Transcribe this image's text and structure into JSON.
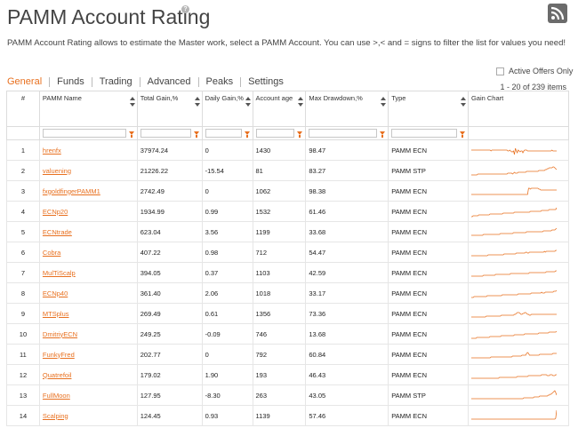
{
  "header": {
    "title": "PAMM Account Rating",
    "help_symbol": "?",
    "description": "PAMM Account Rating allows to estimate the Master work, select a PAMM Account. You can use >,< and = signs to filter the list for values you need!"
  },
  "tabs": [
    {
      "label": "General",
      "active": true
    },
    {
      "label": "Funds",
      "active": false
    },
    {
      "label": "Trading",
      "active": false
    },
    {
      "label": "Advanced",
      "active": false
    },
    {
      "label": "Peaks",
      "active": false
    },
    {
      "label": "Settings",
      "active": false
    }
  ],
  "filter_toggle": {
    "label": "Active Offers Only",
    "checked": false
  },
  "pagination": {
    "text": "1 - 20 of 239 items"
  },
  "columns": [
    {
      "label": "#"
    },
    {
      "label": "PAMM Name"
    },
    {
      "label": "Total Gain,%"
    },
    {
      "label": "Daily Gain,%"
    },
    {
      "label": "Account age"
    },
    {
      "label": "Max Drawdown,%"
    },
    {
      "label": "Type"
    },
    {
      "label": "Gain Chart"
    }
  ],
  "rows": [
    {
      "n": "1",
      "name": "hrenfx",
      "total": "37974.24",
      "daily": "0",
      "age": "1430",
      "dd": "98.47",
      "type": "PAMM ECN",
      "spark": [
        8,
        8,
        8,
        8,
        8,
        8,
        8,
        8,
        8,
        8,
        8,
        8,
        8,
        8,
        8,
        8,
        8,
        8,
        8,
        8,
        8,
        9,
        8,
        8,
        8,
        8,
        8,
        8,
        8,
        8,
        8,
        8,
        8,
        8,
        8,
        8,
        8,
        8,
        8,
        9,
        9,
        8,
        9,
        10,
        10,
        9,
        13,
        6,
        9,
        11,
        8,
        9,
        10,
        9,
        9,
        11,
        9,
        8,
        8,
        8,
        9,
        9,
        9,
        9,
        9,
        9,
        9,
        9,
        9,
        9,
        9,
        9,
        9,
        9,
        9,
        9,
        9,
        9,
        9,
        9,
        9,
        9,
        9,
        9,
        9,
        9,
        8,
        9,
        9,
        9,
        9,
        9
      ]
    },
    {
      "n": "2",
      "name": "valuening",
      "total": "21226.22",
      "daily": "-15.54",
      "age": "81",
      "dd": "83.27",
      "type": "PAMM STP",
      "spark": [
        13,
        13,
        13,
        13,
        13,
        13,
        13,
        12,
        12,
        12,
        12,
        12,
        12,
        12,
        12,
        12,
        12,
        12,
        12,
        12,
        12,
        12,
        12,
        12,
        12,
        12,
        12,
        12,
        12,
        12,
        12,
        12,
        12,
        12,
        12,
        12,
        12,
        12,
        12,
        11,
        11,
        11,
        11,
        11,
        12,
        11,
        10,
        11,
        11,
        11,
        10,
        10,
        10,
        10,
        10,
        10,
        10,
        10,
        10,
        9,
        9,
        9,
        9,
        9,
        9,
        9,
        9,
        9,
        9,
        9,
        9,
        9,
        8,
        8,
        8,
        8,
        8,
        8,
        8,
        7,
        7,
        6,
        6,
        5,
        5,
        5,
        5,
        4,
        4,
        5,
        6,
        7
      ]
    },
    {
      "n": "3",
      "name": "fxgoldfingerPAMM1",
      "total": "2742.49",
      "daily": "0",
      "age": "1062",
      "dd": "98.38",
      "type": "PAMM ECN",
      "spark": [
        12,
        12,
        12,
        12,
        12,
        12,
        12,
        12,
        12,
        12,
        12,
        12,
        12,
        12,
        12,
        12,
        12,
        12,
        12,
        12,
        12,
        12,
        12,
        12,
        12,
        12,
        12,
        12,
        12,
        12,
        12,
        12,
        12,
        12,
        12,
        12,
        12,
        12,
        12,
        12,
        12,
        12,
        12,
        12,
        12,
        12,
        12,
        12,
        12,
        12,
        12,
        12,
        12,
        12,
        12,
        12,
        12,
        12,
        12,
        12,
        12,
        5,
        5,
        6,
        5,
        5,
        5,
        5,
        5,
        5,
        5,
        5,
        6,
        6,
        7,
        7,
        7,
        7,
        7,
        7,
        7,
        7,
        7,
        7,
        7,
        7,
        7,
        7,
        7,
        7,
        7,
        7
      ]
    },
    {
      "n": "4",
      "name": "ECNp20",
      "total": "1934.99",
      "daily": "0.99",
      "age": "1532",
      "dd": "61.46",
      "type": "PAMM ECN",
      "spark": [
        14,
        14,
        13,
        13,
        13,
        13,
        13,
        13,
        12,
        12,
        12,
        12,
        12,
        12,
        12,
        12,
        12,
        12,
        12,
        12,
        11,
        11,
        11,
        11,
        11,
        11,
        11,
        11,
        11,
        11,
        11,
        11,
        11,
        11,
        10,
        10,
        10,
        10,
        10,
        10,
        10,
        10,
        10,
        10,
        10,
        10,
        9,
        9,
        9,
        9,
        9,
        9,
        9,
        9,
        9,
        9,
        9,
        9,
        9,
        9,
        9,
        9,
        9,
        8,
        8,
        8,
        8,
        8,
        8,
        8,
        8,
        8,
        8,
        8,
        8,
        7,
        7,
        7,
        7,
        7,
        7,
        7,
        7,
        6,
        6,
        6,
        6,
        6,
        6,
        6,
        6,
        4
      ]
    },
    {
      "n": "5",
      "name": "ECNtrade",
      "total": "623.04",
      "daily": "3.56",
      "age": "1199",
      "dd": "33.68",
      "type": "PAMM ECN",
      "spark": [
        12,
        12,
        12,
        12,
        12,
        12,
        12,
        12,
        12,
        12,
        12,
        12,
        12,
        11,
        11,
        11,
        11,
        11,
        11,
        11,
        11,
        11,
        11,
        11,
        11,
        11,
        11,
        11,
        11,
        11,
        11,
        10,
        10,
        10,
        10,
        10,
        10,
        10,
        10,
        10,
        10,
        10,
        10,
        10,
        10,
        9,
        9,
        9,
        9,
        9,
        9,
        9,
        9,
        9,
        9,
        9,
        9,
        9,
        9,
        8,
        8,
        8,
        8,
        8,
        8,
        8,
        8,
        8,
        8,
        8,
        8,
        8,
        8,
        8,
        8,
        8,
        8,
        7,
        7,
        7,
        7,
        7,
        7,
        7,
        7,
        7,
        6,
        6,
        6,
        6,
        5,
        4
      ]
    },
    {
      "n": "6",
      "name": "Cobra",
      "total": "407.22",
      "daily": "0.98",
      "age": "712",
      "dd": "54.47",
      "type": "PAMM ECN",
      "spark": [
        12,
        12,
        12,
        12,
        12,
        12,
        12,
        12,
        12,
        12,
        12,
        12,
        12,
        12,
        12,
        12,
        12,
        12,
        11,
        11,
        11,
        11,
        11,
        11,
        11,
        11,
        11,
        11,
        11,
        11,
        11,
        11,
        11,
        11,
        11,
        10,
        10,
        10,
        10,
        10,
        10,
        10,
        10,
        10,
        10,
        10,
        10,
        10,
        9,
        9,
        9,
        9,
        9,
        9,
        9,
        9,
        9,
        9,
        8,
        8,
        9,
        9,
        8,
        8,
        8,
        8,
        8,
        8,
        8,
        8,
        8,
        8,
        8,
        8,
        8,
        8,
        8,
        8,
        7,
        8,
        7,
        7,
        7,
        7,
        7,
        7,
        7,
        7,
        7,
        7,
        6,
        6
      ]
    },
    {
      "n": "7",
      "name": "MulTiScalp",
      "total": "394.05",
      "daily": "0.37",
      "age": "1103",
      "dd": "42.59",
      "type": "PAMM ECN",
      "spark": [
        12,
        12,
        12,
        12,
        12,
        12,
        12,
        12,
        12,
        12,
        12,
        12,
        12,
        11,
        11,
        11,
        11,
        11,
        11,
        11,
        11,
        11,
        11,
        11,
        11,
        11,
        10,
        10,
        10,
        10,
        10,
        10,
        10,
        10,
        10,
        10,
        10,
        10,
        10,
        10,
        10,
        10,
        9,
        9,
        9,
        9,
        9,
        9,
        9,
        9,
        9,
        9,
        9,
        9,
        9,
        9,
        9,
        9,
        9,
        9,
        9,
        9,
        8,
        8,
        8,
        8,
        8,
        8,
        8,
        8,
        8,
        8,
        8,
        8,
        8,
        8,
        8,
        8,
        8,
        8,
        7,
        7,
        7,
        7,
        7,
        7,
        7,
        7,
        7,
        7,
        6,
        6
      ]
    },
    {
      "n": "8",
      "name": "ECNp40",
      "total": "361.40",
      "daily": "2.06",
      "age": "1018",
      "dd": "33.17",
      "type": "PAMM ECN",
      "spark": [
        13,
        13,
        13,
        12,
        12,
        12,
        12,
        12,
        12,
        12,
        12,
        12,
        12,
        12,
        12,
        12,
        12,
        11,
        11,
        11,
        11,
        11,
        11,
        11,
        11,
        11,
        11,
        11,
        11,
        11,
        11,
        11,
        11,
        10,
        10,
        10,
        10,
        10,
        10,
        10,
        10,
        10,
        10,
        10,
        10,
        10,
        10,
        10,
        10,
        10,
        9,
        9,
        9,
        9,
        9,
        9,
        9,
        9,
        9,
        9,
        9,
        9,
        9,
        9,
        8,
        8,
        8,
        8,
        8,
        8,
        8,
        8,
        8,
        8,
        8,
        7,
        8,
        8,
        8,
        7,
        7,
        7,
        7,
        7,
        7,
        7,
        7,
        7,
        6,
        6,
        6,
        5
      ]
    },
    {
      "n": "9",
      "name": "MTSplus",
      "total": "269.49",
      "daily": "0.61",
      "age": "1356",
      "dd": "73.36",
      "type": "PAMM ECN",
      "spark": [
        12,
        12,
        12,
        12,
        12,
        12,
        12,
        12,
        12,
        12,
        12,
        12,
        12,
        12,
        12,
        12,
        11,
        11,
        11,
        11,
        11,
        11,
        11,
        11,
        11,
        11,
        11,
        11,
        11,
        11,
        11,
        11,
        10,
        10,
        10,
        10,
        10,
        10,
        10,
        10,
        10,
        10,
        10,
        10,
        10,
        10,
        9,
        9,
        8,
        7,
        7,
        7,
        8,
        9,
        9,
        8,
        8,
        7,
        7,
        8,
        9,
        9,
        10,
        10,
        9,
        9,
        9,
        9,
        9,
        9,
        9,
        9,
        9,
        9,
        9,
        9,
        9,
        9,
        9,
        9,
        9,
        9,
        9,
        9,
        9,
        9,
        9,
        9,
        9,
        9,
        9,
        9
      ]
    },
    {
      "n": "10",
      "name": "DmitriyECN",
      "total": "249.25",
      "daily": "-0.09",
      "age": "746",
      "dd": "13.68",
      "type": "PAMM ECN",
      "spark": [
        13,
        13,
        13,
        13,
        13,
        13,
        12,
        12,
        12,
        12,
        12,
        12,
        12,
        12,
        12,
        12,
        12,
        12,
        12,
        12,
        11,
        11,
        11,
        11,
        11,
        11,
        11,
        11,
        11,
        11,
        11,
        11,
        10,
        10,
        10,
        10,
        10,
        10,
        10,
        10,
        10,
        10,
        10,
        10,
        10,
        10,
        9,
        9,
        9,
        9,
        9,
        9,
        9,
        9,
        9,
        9,
        9,
        8,
        8,
        8,
        8,
        8,
        8,
        8,
        8,
        8,
        8,
        8,
        8,
        8,
        8,
        8,
        7,
        7,
        7,
        7,
        7,
        7,
        7,
        7,
        7,
        7,
        7,
        6,
        6,
        6,
        6,
        6,
        6,
        6,
        6,
        5
      ]
    },
    {
      "n": "11",
      "name": "FunkyFred",
      "total": "202.77",
      "daily": "0",
      "age": "792",
      "dd": "60.84",
      "type": "PAMM ECN",
      "spark": [
        12,
        12,
        12,
        12,
        12,
        12,
        12,
        12,
        12,
        12,
        12,
        12,
        12,
        12,
        12,
        12,
        12,
        12,
        12,
        12,
        12,
        11,
        11,
        11,
        11,
        11,
        11,
        11,
        11,
        11,
        11,
        11,
        11,
        11,
        11,
        11,
        11,
        11,
        11,
        11,
        11,
        11,
        11,
        11,
        10,
        10,
        10,
        10,
        10,
        10,
        10,
        10,
        10,
        10,
        9,
        9,
        9,
        9,
        9,
        7,
        6,
        7,
        9,
        9,
        9,
        9,
        9,
        9,
        9,
        9,
        9,
        9,
        9,
        8,
        8,
        8,
        8,
        8,
        8,
        8,
        8,
        8,
        8,
        8,
        8,
        8,
        8,
        7,
        7,
        7,
        7,
        7
      ]
    },
    {
      "n": "12",
      "name": "Quatrefoil",
      "total": "179.02",
      "daily": "1.90",
      "age": "193",
      "dd": "46.43",
      "type": "PAMM ECN",
      "spark": [
        12,
        12,
        12,
        12,
        12,
        12,
        12,
        12,
        12,
        12,
        12,
        12,
        12,
        12,
        12,
        12,
        12,
        12,
        12,
        12,
        12,
        12,
        12,
        12,
        12,
        12,
        12,
        12,
        12,
        12,
        11,
        11,
        11,
        11,
        11,
        11,
        11,
        11,
        11,
        11,
        11,
        11,
        11,
        11,
        11,
        11,
        11,
        11,
        11,
        10,
        10,
        10,
        10,
        10,
        10,
        10,
        10,
        10,
        10,
        10,
        10,
        9,
        9,
        9,
        9,
        9,
        9,
        9,
        9,
        9,
        9,
        9,
        9,
        9,
        9,
        8,
        8,
        8,
        8,
        8,
        8,
        9,
        9,
        9,
        8,
        8,
        8,
        9,
        9,
        9,
        8,
        8
      ]
    },
    {
      "n": "13",
      "name": "FullMoon",
      "total": "127.95",
      "daily": "-8.30",
      "age": "263",
      "dd": "43.05",
      "type": "PAMM STP",
      "spark": [
        12,
        12,
        12,
        12,
        12,
        12,
        12,
        12,
        12,
        12,
        12,
        12,
        12,
        12,
        12,
        12,
        12,
        12,
        12,
        12,
        12,
        12,
        12,
        12,
        12,
        12,
        12,
        12,
        12,
        12,
        12,
        12,
        12,
        12,
        12,
        12,
        12,
        12,
        12,
        12,
        12,
        12,
        12,
        12,
        12,
        12,
        12,
        12,
        12,
        12,
        12,
        12,
        12,
        12,
        12,
        12,
        11,
        11,
        11,
        11,
        11,
        11,
        11,
        11,
        11,
        11,
        11,
        10,
        10,
        10,
        10,
        10,
        10,
        9,
        9,
        9,
        9,
        9,
        9,
        9,
        9,
        9,
        8,
        8,
        7,
        7,
        6,
        5,
        4,
        3,
        5,
        8
      ]
    },
    {
      "n": "14",
      "name": "Scalping",
      "total": "124.45",
      "daily": "0.93",
      "age": "1139",
      "dd": "57.46",
      "type": "PAMM ECN",
      "spark": [
        12,
        12,
        12,
        12,
        12,
        12,
        12,
        12,
        12,
        12,
        12,
        12,
        12,
        12,
        12,
        12,
        12,
        12,
        12,
        12,
        12,
        12,
        12,
        12,
        12,
        12,
        12,
        12,
        12,
        12,
        12,
        12,
        12,
        12,
        12,
        12,
        12,
        12,
        12,
        12,
        12,
        12,
        12,
        12,
        12,
        12,
        12,
        12,
        12,
        12,
        12,
        12,
        12,
        12,
        12,
        12,
        12,
        12,
        12,
        12,
        12,
        12,
        12,
        12,
        12,
        12,
        12,
        12,
        12,
        12,
        12,
        12,
        12,
        12,
        12,
        12,
        12,
        12,
        12,
        12,
        12,
        12,
        12,
        12,
        12,
        12,
        12,
        12,
        12,
        12,
        11,
        2
      ]
    }
  ],
  "colors": {
    "accent": "#e8701f",
    "grid_border": "#dcdcdc",
    "rss_bg": "#6b6b6b"
  },
  "icons": {
    "help": "help-icon",
    "rss": "rss-icon",
    "sort": "sort-icon",
    "filter": "filter-icon"
  }
}
